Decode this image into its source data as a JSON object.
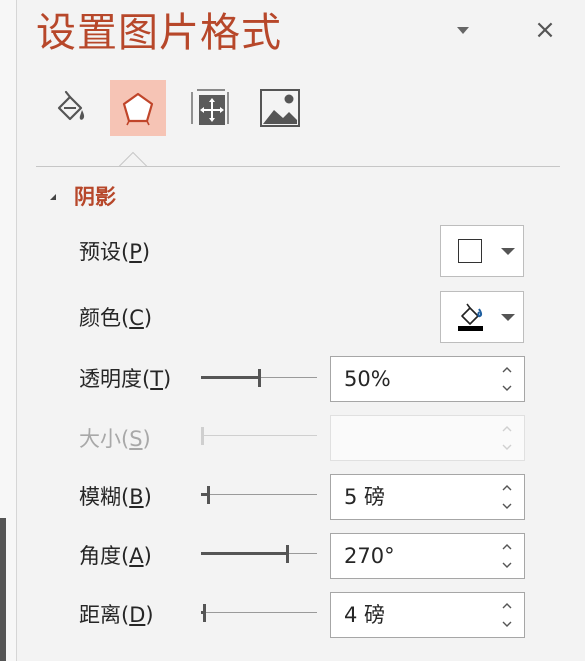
{
  "pane": {
    "title": "设置图片格式",
    "options_icon": "chevron-down-icon",
    "close_icon": "close-icon",
    "close_glyph": "×"
  },
  "tabs": [
    {
      "name": "fill-and-line",
      "icon": "paint-bucket-icon",
      "active": false
    },
    {
      "name": "effects",
      "icon": "pentagon-icon",
      "active": true
    },
    {
      "name": "size-and-properties",
      "icon": "size-properties-icon",
      "active": false
    },
    {
      "name": "picture",
      "icon": "picture-icon",
      "active": false
    }
  ],
  "section": {
    "title": "阴影",
    "expanded": true
  },
  "rows": {
    "preset": {
      "label": "预设(",
      "key": "P",
      "label_end": ")"
    },
    "color": {
      "label": "颜色(",
      "key": "C",
      "label_end": ")",
      "value_color": "#000000"
    },
    "transparency": {
      "label": "透明度(",
      "key": "T",
      "label_end": ")",
      "value": "50%",
      "slider_fraction": 0.5
    },
    "size": {
      "label": "大小(",
      "key": "S",
      "label_end": ")",
      "value": "",
      "disabled": true,
      "slider_fraction": 0.0
    },
    "blur": {
      "label": "模糊(",
      "key": "B",
      "label_end": ")",
      "value": "5 磅",
      "slider_fraction": 0.05
    },
    "angle": {
      "label": "角度(",
      "key": "A",
      "label_end": ")",
      "value": "270°",
      "slider_fraction": 0.75
    },
    "distance": {
      "label": "距离(",
      "key": "D",
      "label_end": ")",
      "value": "4 磅",
      "slider_fraction": 0.02
    }
  },
  "colors": {
    "accent": "#b7472a",
    "active_tab": "#f6c4b5",
    "panel_bg": "#f3f3f3"
  }
}
